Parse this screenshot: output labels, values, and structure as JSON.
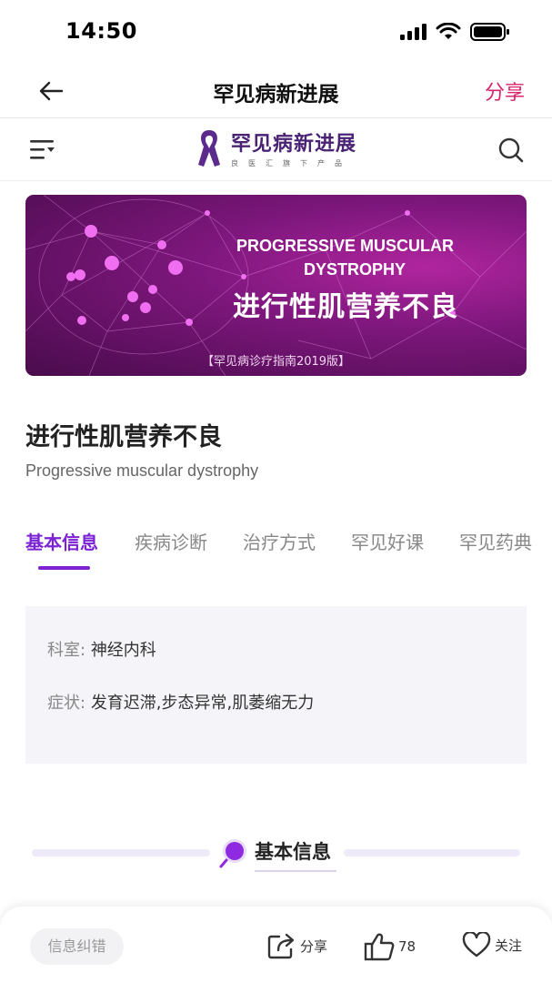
{
  "status_bar": {
    "time": "14:50"
  },
  "nav": {
    "title": "罕见病新进展",
    "share_label": "分享",
    "back_icon": "arrow-left-icon"
  },
  "brand": {
    "name": "罕见病新进展",
    "subtitle": "良医汇旗下产品",
    "menu_icon": "menu-filter-icon",
    "search_icon": "search-icon"
  },
  "banner": {
    "title_en_line1": "PROGRESSIVE MUSCULAR",
    "title_en_line2": "DYSTROPHY",
    "title_cn": "进行性肌营养不良",
    "caption": "【罕见病诊疗指南2019版】"
  },
  "disease": {
    "title": "进行性肌营养不良",
    "english_name": "Progressive muscular dystrophy"
  },
  "tabs": [
    {
      "label": "基本信息",
      "active": true
    },
    {
      "label": "疾病诊断",
      "active": false
    },
    {
      "label": "治疗方式",
      "active": false
    },
    {
      "label": "罕见好课",
      "active": false
    },
    {
      "label": "罕见药典",
      "active": false
    }
  ],
  "info": {
    "department_label": "科室:",
    "department_value": "神经内科",
    "symptoms_label": "症状:",
    "symptoms_value": "发育迟滞,步态异常,肌萎缩无力"
  },
  "section": {
    "title": "基本信息"
  },
  "bottom_bar": {
    "report_label": "信息纠错",
    "share_label": "分享",
    "like_count": "78",
    "follow_label": "关注"
  },
  "colors": {
    "accent": "#7b22d4",
    "share_pink": "#d8246e",
    "brand_purple": "#4a2374",
    "banner_magenta": "#8a1a88"
  }
}
